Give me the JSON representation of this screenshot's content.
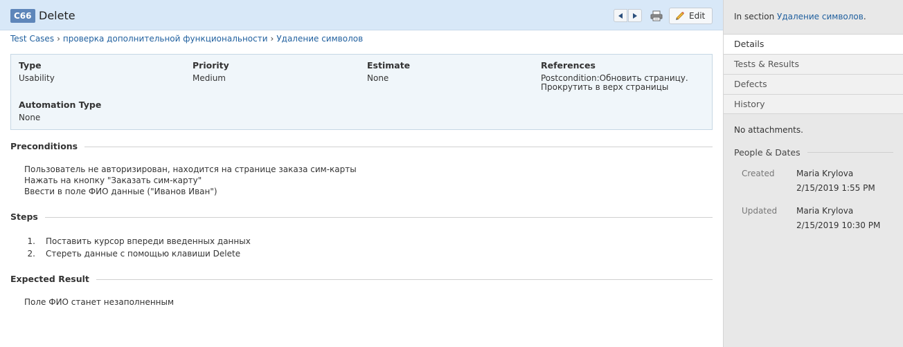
{
  "header": {
    "case_id": "C66",
    "title": "Delete",
    "edit_label": "Edit"
  },
  "breadcrumb": [
    "Test Cases",
    "проверка дополнительной функциональности",
    "Удаление символов"
  ],
  "fields": {
    "type": {
      "label": "Type",
      "value": "Usability"
    },
    "priority": {
      "label": "Priority",
      "value": "Medium"
    },
    "estimate": {
      "label": "Estimate",
      "value": "None"
    },
    "references": {
      "label": "References",
      "line1": "Postcondition:Обновить страницу.",
      "line2": "Прокрутить в верх страницы"
    },
    "automation": {
      "label": "Automation Type",
      "value": "None"
    }
  },
  "preconditions": {
    "title": "Preconditions",
    "lines": [
      "Пользователь не авторизирован, находится на странице заказа сим-карты",
      "Нажать на кнопку \"Заказать сим-карту\"",
      "Ввести в поле ФИО данные (\"Иванов Иван\")"
    ]
  },
  "steps": {
    "title": "Steps",
    "items": [
      {
        "num": "1",
        "text": "Поставить курсор впереди введенных данных"
      },
      {
        "num": "2",
        "text": "Стереть данные с помощью клавиши Delete"
      }
    ]
  },
  "expected": {
    "title": "Expected Result",
    "text": "Поле ФИО станет незаполненным"
  },
  "sidebar": {
    "in_section_prefix": "In section",
    "section_link": "Удаление символов",
    "section_suffix": ".",
    "tabs": [
      "Details",
      "Tests & Results",
      "Defects",
      "History"
    ],
    "attachments": "No attachments.",
    "people_title": "People & Dates",
    "created": {
      "label": "Created",
      "name": "Maria Krylova",
      "date": "2/15/2019 1:55 PM"
    },
    "updated": {
      "label": "Updated",
      "name": "Maria Krylova",
      "date": "2/15/2019 10:30 PM"
    }
  },
  "colors": {
    "accent": "#5e86ba",
    "link": "#1f5f9e",
    "header_bg": "#d8e8f8"
  }
}
